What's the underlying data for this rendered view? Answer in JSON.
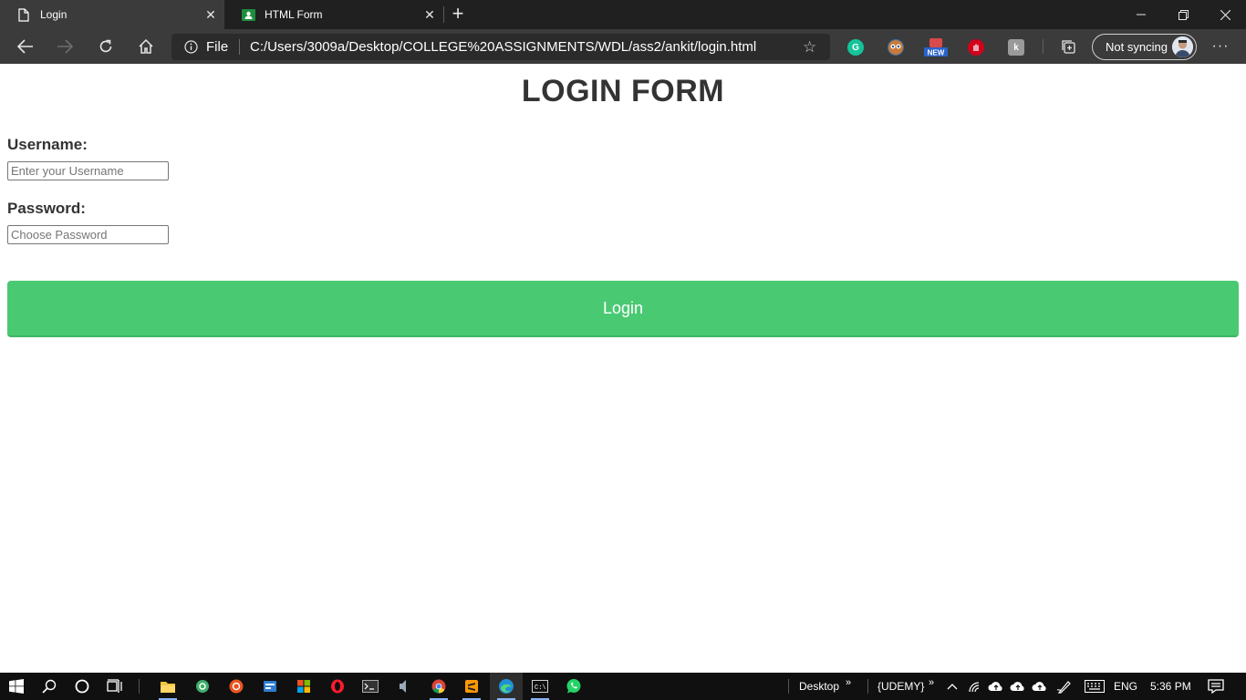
{
  "browser": {
    "tabs": [
      {
        "title": "Login",
        "icon": "page-icon",
        "active": true
      },
      {
        "title": "HTML Form",
        "icon": "form-favicon",
        "active": false
      }
    ],
    "address": {
      "scheme_label": "File",
      "url": "C:/Users/3009a/Desktop/COLLEGE%20ASSIGNMENTS/WDL/ass2/ankit/login.html"
    },
    "profile_label": "Not syncing",
    "extensions": [
      "grammarly-icon",
      "owl-extension-icon",
      "new-badge-extension-icon",
      "stop-hand-extension-icon",
      "k-extension-icon"
    ],
    "ext_badge_text": "NEW"
  },
  "page": {
    "title": "LOGIN FORM",
    "username_label": "Username:",
    "username_placeholder": "Enter your Username",
    "password_label": "Password:",
    "password_placeholder": "Choose Password",
    "login_button": "Login"
  },
  "colors": {
    "accent_green": "#4ac973",
    "chrome_dark": "#3b3b3b"
  },
  "taskbar": {
    "apps": [
      "file-explorer-icon",
      "app-green-icon",
      "ubuntu-icon",
      "app-blue-icon",
      "windows-store-icon",
      "opera-icon",
      "terminal-icon",
      "audio-app-icon",
      "chrome-icon",
      "sublime-text-icon",
      "edge-icon",
      "cmd-icon",
      "whatsapp-icon"
    ],
    "toolbar_desktop": "Desktop",
    "toolbar_udemy": "{UDEMY}",
    "language": "ENG",
    "time": "5:36 PM"
  }
}
